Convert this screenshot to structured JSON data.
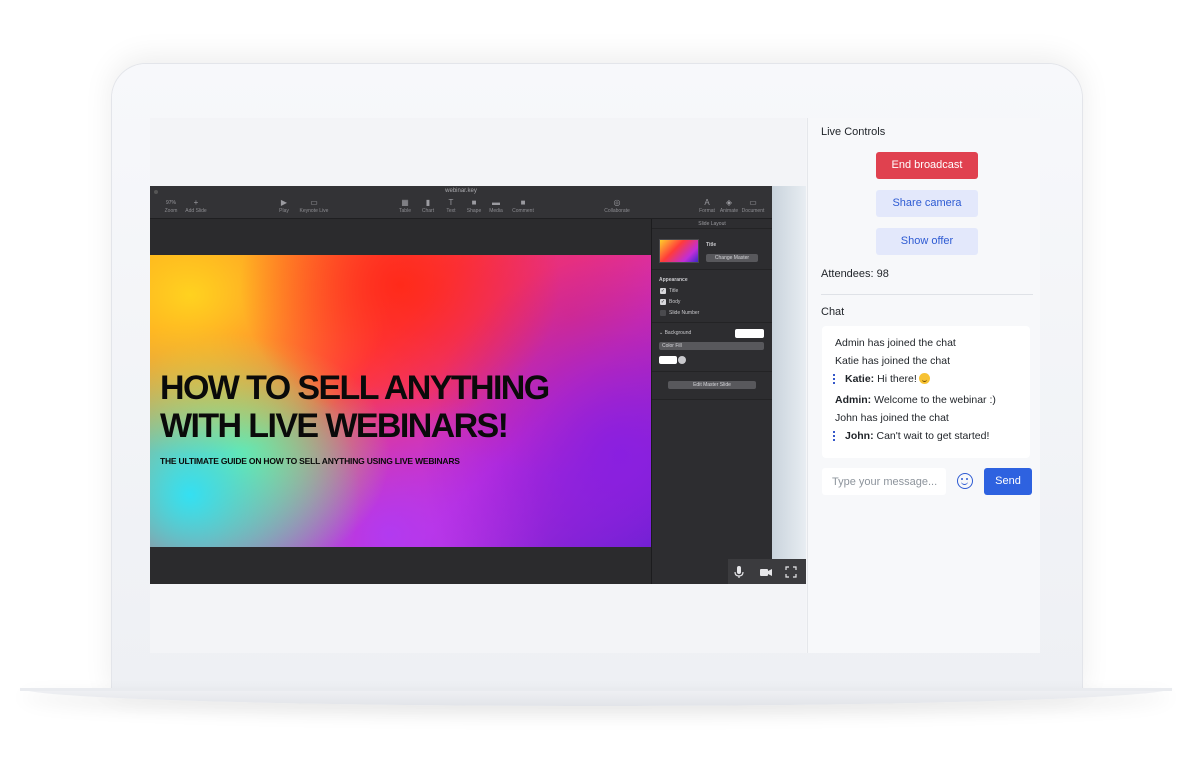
{
  "keynote": {
    "window_title": "webinar.key",
    "zoom": "97%",
    "tools": [
      {
        "label": "Zoom",
        "icon": "zoom-icon"
      },
      {
        "label": "Add Slide",
        "icon": "plus-icon"
      },
      {
        "label": "Play",
        "icon": "play-icon"
      },
      {
        "label": "Keynote Live",
        "icon": "live-icon"
      },
      {
        "label": "Table",
        "icon": "table-icon"
      },
      {
        "label": "Chart",
        "icon": "chart-icon"
      },
      {
        "label": "Text",
        "icon": "text-icon"
      },
      {
        "label": "Shape",
        "icon": "shape-icon"
      },
      {
        "label": "Media",
        "icon": "media-icon"
      },
      {
        "label": "Comment",
        "icon": "comment-icon"
      },
      {
        "label": "Collaborate",
        "icon": "collaborate-icon"
      },
      {
        "label": "Format",
        "icon": "format-icon"
      },
      {
        "label": "Animate",
        "icon": "animate-icon"
      },
      {
        "label": "Document",
        "icon": "document-icon"
      }
    ],
    "slide": {
      "title_line1": "HOW TO SELL ANYTHING",
      "title_line2": "WITH LIVE WEBINARS!",
      "subtitle": "THE ULTIMATE GUIDE ON HOW TO SELL ANYTHING USING LIVE WEBINARS"
    },
    "inspector": {
      "header": "Slide Layout",
      "master_name": "Title",
      "change_master": "Change Master",
      "appearance": "Appearance",
      "checks": [
        "Title",
        "Body",
        "Slide Number"
      ],
      "checked": [
        true,
        true,
        false
      ],
      "background": "Background",
      "fill_type": "Color Fill",
      "edit_master": "Edit Master Slide"
    }
  },
  "video_controls": {
    "icons": [
      "microphone-icon",
      "camera-icon",
      "fullscreen-icon"
    ]
  },
  "live_controls": {
    "title": "Live Controls",
    "end_broadcast": "End broadcast",
    "share_camera": "Share camera",
    "show_offer": "Show offer",
    "attendees_label": "Attendees:",
    "attendees_count": "98"
  },
  "chat": {
    "title": "Chat",
    "messages": [
      {
        "author": "",
        "text": "Admin has joined the chat"
      },
      {
        "author": "",
        "text": "Katie has joined the chat"
      },
      {
        "author": "Katie:",
        "text": "Hi there!"
      },
      {
        "author": "Admin:",
        "text": "Welcome to the webinar :)"
      },
      {
        "author": "",
        "text": "John has joined the chat"
      },
      {
        "author": "John:",
        "text": "Can't wait to get started!"
      }
    ],
    "input_placeholder": "Type your message...",
    "send_label": "Send"
  },
  "colors": {
    "end_broadcast": "#e0414f",
    "send": "#2e62e0",
    "soft_button": "#e3e8fb",
    "accent_text": "#2e5bd3"
  }
}
